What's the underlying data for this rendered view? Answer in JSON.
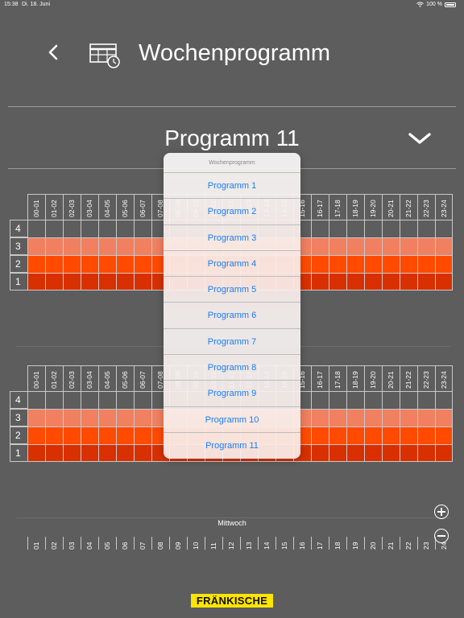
{
  "status": {
    "time": "15:38",
    "date": "Di. 18. Juni",
    "battery": "100 %"
  },
  "header": {
    "title": "Wochenprogramm"
  },
  "program_select": {
    "current": "Programm 11"
  },
  "hours": [
    "00-01",
    "01-02",
    "02-03",
    "03-04",
    "04-05",
    "05-06",
    "06-07",
    "07-08",
    "08-09",
    "09-10",
    "10-11",
    "11-12",
    "12-13",
    "13-14",
    "14-15",
    "15-16",
    "16-17",
    "17-18",
    "18-19",
    "19-20",
    "20-21",
    "21-22",
    "22-23",
    "23-24"
  ],
  "hour_nums": [
    "01",
    "02",
    "03",
    "04",
    "05",
    "06",
    "07",
    "08",
    "09",
    "10",
    "11",
    "12",
    "13",
    "14",
    "15",
    "16",
    "17",
    "18",
    "19",
    "20",
    "21",
    "22",
    "23",
    "24"
  ],
  "row_labels": [
    "4",
    "3",
    "2",
    "1"
  ],
  "day_label": "Mittwoch",
  "popover": {
    "title": "Wochenprogramm",
    "items": [
      "Programm 1",
      "Programm 2",
      "Programm 3",
      "Programm 4",
      "Programm 5",
      "Programm 6",
      "Programm 7",
      "Programm 8",
      "Programm 9",
      "Programm 10",
      "Programm 11"
    ]
  },
  "logo": "FRÄNKISCHE",
  "colors": {
    "level3": "#f08060",
    "level2": "#ff4a00",
    "level1": "#d83000",
    "link": "#1a7df0"
  }
}
